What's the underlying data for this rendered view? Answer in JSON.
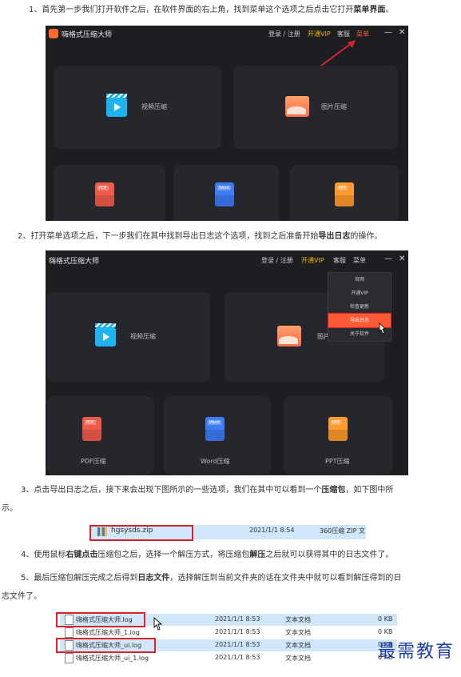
{
  "steps": {
    "s1": {
      "pre": "1、首先第一步我们打开软件之后，在软件界面的右上角，找到菜单这个选项之后点击它打开",
      "bold": "菜单界面",
      "post": "。"
    },
    "s2": {
      "pre": "2、打开菜单选项之后，下一步我们在其中找到导出日志这个选项，找到之后准备开始",
      "bold": "导出日志",
      "post": "的操作。"
    },
    "s3": {
      "pre": "3、点击导出日志之后，接下来会出现下图所示的一些选项，我们在其中可以看到一个",
      "bold": "压缩包",
      "post": "，如下图中所",
      "line2": "示。"
    },
    "s4": {
      "pre": "4、使用鼠标",
      "bold": "右键点击",
      "post": "压缩包之后，选择一个解压方式，将压缩包",
      "bold2": "解压",
      "post2": "之后就可以获得其中的日志文件了。"
    },
    "s5": {
      "pre": "5、最后压缩包解压完成之后得到",
      "bold": "日志文件",
      "post": "，选择解压到当前文件夹的话在文件夹中就可以看到解压得到的日",
      "line2": "志文件了。"
    }
  },
  "app": {
    "title": "嗨格式压缩大师",
    "login": "登录 / 注册",
    "vip": "开通VIP",
    "service": "客服",
    "menu": "菜单",
    "minimize": "—",
    "close": "✕",
    "cards": {
      "video": "视频压缩",
      "image": "图片压缩",
      "pdf": "PDF压缩",
      "word": "Word压缩",
      "ppt": "PPT压缩"
    },
    "file_tags": {
      "pdf": "PDF",
      "word": "Word",
      "ppt": "PPT"
    },
    "dropdown": [
      "官网",
      "开通VIP",
      "检查更新",
      "导出日志",
      "关于软件"
    ]
  },
  "zip_file": {
    "name": "hgsysds.zip",
    "date": "2021/1/1 8:54",
    "type": "360压缩 ZIP 文"
  },
  "log_files": [
    {
      "name": "嗨格式压缩大师.log",
      "date": "2021/1/1 8:53",
      "type": "文本文档",
      "size": "0 KB"
    },
    {
      "name": "嗨格式压缩大师_1.log",
      "date": "2021/1/1 8:53",
      "type": "文本文档",
      "size": "0 KB"
    },
    {
      "name": "嗨格式压缩大师_ui.log",
      "date": "2021/1/1 8:53",
      "type": "文本文档",
      "size": "0 KB"
    },
    {
      "name": "嗨格式压缩大师_ui_1.log",
      "date": "2021/1/1 8:53",
      "type": "文本文档",
      "size": "0 KB"
    }
  ],
  "watermark": "最需教育",
  "colors": {
    "accent_red": "#d9232d",
    "vip_gold": "#f7b500",
    "app_bg": "#1d1e22",
    "selection_blue": "#cfe6fb",
    "watermark_blue": "#1b3fa8"
  }
}
